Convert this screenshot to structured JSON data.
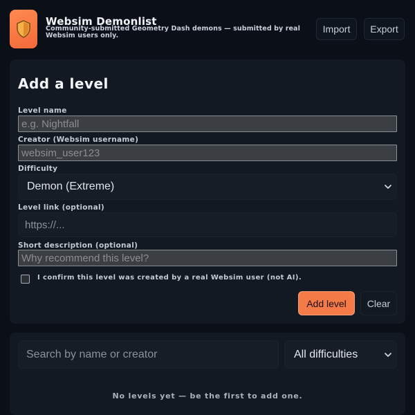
{
  "header": {
    "title": "Websim Demonlist",
    "subtitle": "Community-submitted Geometry Dash demons — submitted by real Websim users only.",
    "import_label": "Import",
    "export_label": "Export",
    "logo_icon": "shield-icon",
    "accent": "#f47a48"
  },
  "form": {
    "heading": "Add a level",
    "level_name": {
      "label": "Level name",
      "placeholder": "e.g. Nightfall",
      "value": ""
    },
    "creator": {
      "label": "Creator (Websim username)",
      "placeholder": "websim_user123",
      "value": ""
    },
    "difficulty": {
      "label": "Difficulty",
      "selected": "Demon (Extreme)"
    },
    "level_link": {
      "label": "Level link (optional)",
      "placeholder": "https://...",
      "value": ""
    },
    "description": {
      "label": "Short description (optional)",
      "placeholder": "Why recommend this level?",
      "value": ""
    },
    "confirm_text": "I confirm this level was created by a real Websim user (not AI).",
    "confirm_checked": false,
    "add_label": "Add level",
    "clear_label": "Clear"
  },
  "list": {
    "search_placeholder": "Search by name or creator",
    "filter_selected": "All difficulties",
    "empty_text": "No levels yet — be the first to add one."
  }
}
